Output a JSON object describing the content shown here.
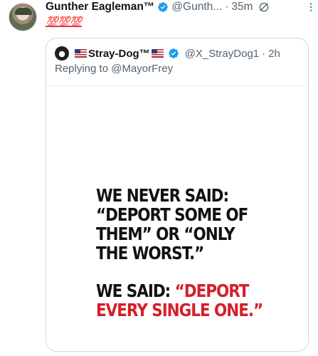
{
  "post": {
    "author_name": "Gunther Eagleman™",
    "handle": "@Gunth...",
    "separator": "·",
    "time": "35m",
    "text": "💯💯💯"
  },
  "quote": {
    "author_name": "Stray-Dog™",
    "handle": "@X_StrayDog1",
    "separator": "·",
    "time": "2h",
    "reply_to": "Replying to @MayorFrey",
    "image_text": {
      "line1": "WE NEVER SAID:",
      "line2": "“DEPORT SOME OF",
      "line3": "THEM” OR “ONLY",
      "line4": "THE WORST.”",
      "line5_black": "WE SAID: ",
      "line5_red": "“DEPORT",
      "line6_red": "EVERY SINGLE ONE.”"
    }
  },
  "colors": {
    "verified_blue": "#1d9bf0",
    "secondary_text": "#536471",
    "slogan_red": "#d41f2b"
  },
  "icons": {
    "verified": "verified-badge-icon",
    "grok": "grok-icon",
    "more": "more-options-icon"
  }
}
